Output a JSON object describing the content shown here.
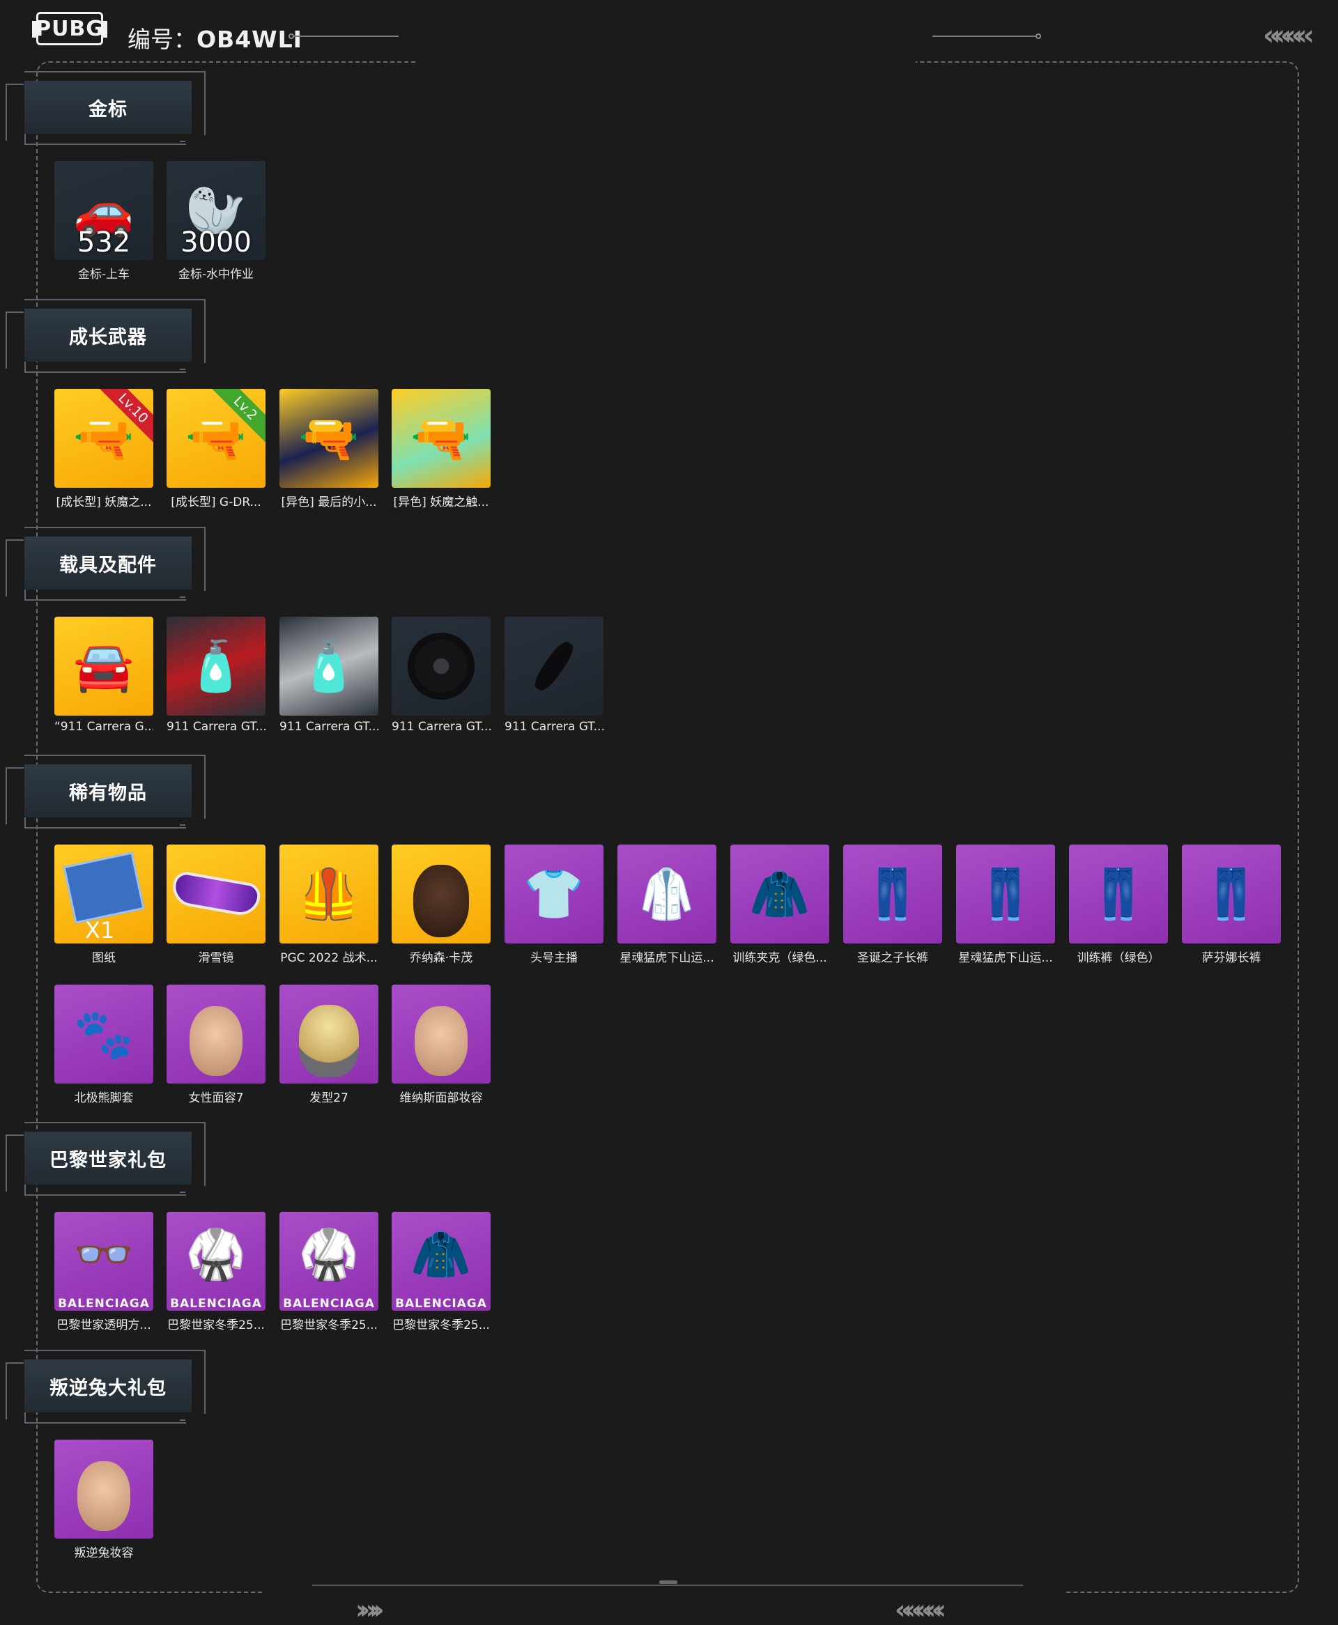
{
  "header": {
    "logo_text": "PUBG",
    "serial_label": "编号：",
    "serial_value": "OB4WLI"
  },
  "sections": {
    "gold": {
      "title": "金标",
      "items": [
        {
          "label": "金标-上车",
          "count": "532"
        },
        {
          "label": "金标-水中作业",
          "count": "3000"
        }
      ]
    },
    "weapons": {
      "title": "成长武器",
      "items": [
        {
          "label": "[成长型] 妖魔之...",
          "badge": "Lv.10"
        },
        {
          "label": "[成长型] G-DR...",
          "badge": "Lv.2"
        },
        {
          "label": "[异色] 最后的小..."
        },
        {
          "label": "[异色] 妖魔之触..."
        }
      ]
    },
    "vehicles": {
      "title": "载具及配件",
      "items": [
        {
          "label": "“911 Carrera G..."
        },
        {
          "label": "911 Carrera GT..."
        },
        {
          "label": "911 Carrera GT..."
        },
        {
          "label": "911 Carrera GT..."
        },
        {
          "label": "911 Carrera GT..."
        }
      ]
    },
    "rare": {
      "title": "稀有物品",
      "items": [
        {
          "label": "图纸",
          "qty": "X1"
        },
        {
          "label": "滑雪镜"
        },
        {
          "label": "PGC 2022 战术..."
        },
        {
          "label": "乔纳森·卡茂"
        },
        {
          "label": "头号主播"
        },
        {
          "label": "星魂猛虎下山运..."
        },
        {
          "label": "训练夹克（绿色..."
        },
        {
          "label": "圣诞之子长裤"
        },
        {
          "label": "星魂猛虎下山运..."
        },
        {
          "label": "训练裤（绿色）"
        },
        {
          "label": "萨芬娜长裤"
        },
        {
          "label": "北极熊脚套"
        },
        {
          "label": "女性面容7"
        },
        {
          "label": "发型27"
        },
        {
          "label": "维纳斯面部妆容"
        }
      ]
    },
    "balenciaga": {
      "title": "巴黎世家礼包",
      "brand": "BALENCIAGA",
      "items": [
        {
          "label": "巴黎世家透明方..."
        },
        {
          "label": "巴黎世家冬季25..."
        },
        {
          "label": "巴黎世家冬季25..."
        },
        {
          "label": "巴黎世家冬季25..."
        }
      ]
    },
    "rabbit": {
      "title": "叛逆兔大礼包",
      "items": [
        {
          "label": "叛逆兔妆容"
        }
      ]
    }
  },
  "icons": {
    "chevrons": "chevron-decoration-icon"
  },
  "colors": {
    "background": "#1b1b1c",
    "gold_tile": "#ffc21a",
    "purple_tile": "#9d3fbf",
    "dark_tile": "#242c35"
  }
}
